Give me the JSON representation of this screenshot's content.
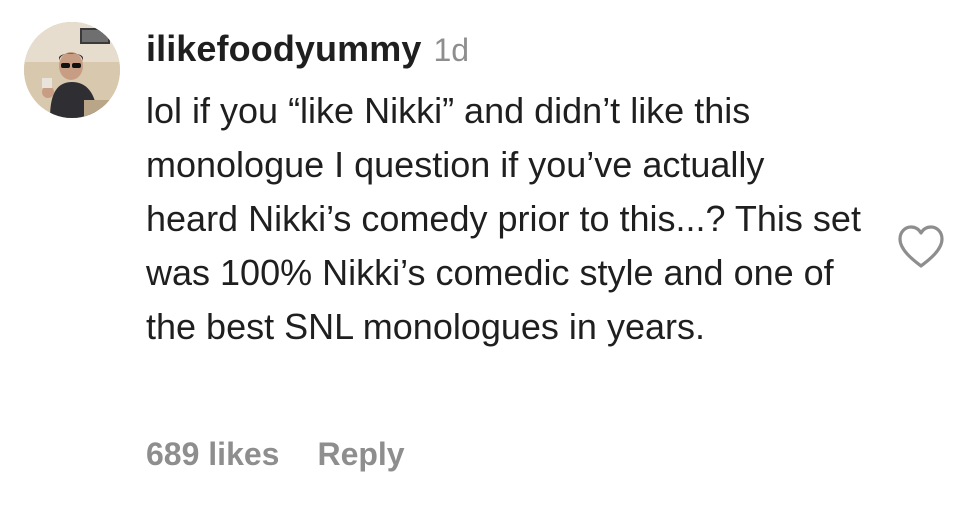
{
  "comment": {
    "username": "ilikefoodyummy",
    "time": "1d",
    "text": "lol if you “like Nikki” and didn’t like this monologue I question if you’ve actually heard Nikki’s comedy prior to this...? This set was 100% Nikki’s comedic style and one of the best SNL monologues in years.",
    "likes_label": "689 likes",
    "reply_label": "Reply"
  },
  "icons": {
    "like": "heart-outline-icon",
    "avatar": "profile-photo"
  },
  "colors": {
    "text": "#1f1f1f",
    "secondary": "#8e8e8e",
    "background": "#ffffff"
  }
}
